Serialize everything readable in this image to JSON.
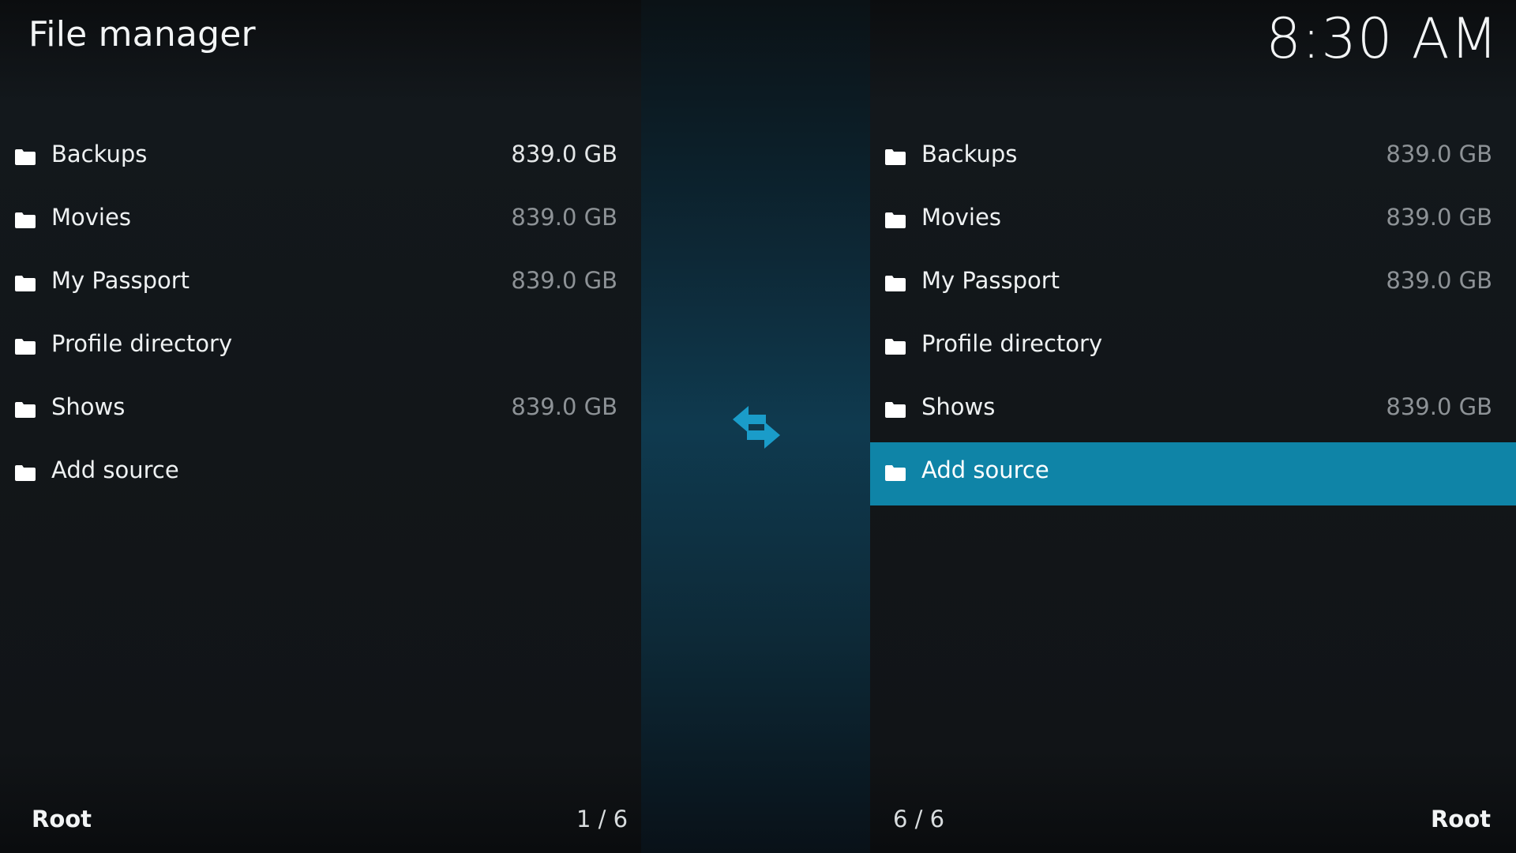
{
  "header": {
    "title": "File manager",
    "clock": "8:30 AM"
  },
  "colors": {
    "accent": "#0f84a7",
    "swap_icon": "#1a9cc9",
    "background": "#111417",
    "muted_text": "#8d9296"
  },
  "left_pane": {
    "items": [
      {
        "label": "Backups",
        "size": "839.0 GB",
        "icon": "folder-icon"
      },
      {
        "label": "Movies",
        "size": "839.0 GB",
        "icon": "folder-icon"
      },
      {
        "label": "My Passport",
        "size": "839.0 GB",
        "icon": "folder-icon"
      },
      {
        "label": "Profile directory",
        "size": "",
        "icon": "folder-icon"
      },
      {
        "label": "Shows",
        "size": "839.0 GB",
        "icon": "folder-icon"
      },
      {
        "label": "Add source",
        "size": "",
        "icon": "folder-icon"
      }
    ],
    "footer_path": "Root",
    "footer_count": "1 / 6"
  },
  "right_pane": {
    "items": [
      {
        "label": "Backups",
        "size": "839.0 GB",
        "icon": "folder-icon"
      },
      {
        "label": "Movies",
        "size": "839.0 GB",
        "icon": "folder-icon"
      },
      {
        "label": "My Passport",
        "size": "839.0 GB",
        "icon": "folder-icon"
      },
      {
        "label": "Profile directory",
        "size": "",
        "icon": "folder-icon"
      },
      {
        "label": "Shows",
        "size": "839.0 GB",
        "icon": "folder-icon"
      },
      {
        "label": "Add source",
        "size": "",
        "icon": "folder-icon",
        "selected": true
      }
    ],
    "footer_path": "Root",
    "footer_count": "6 / 6"
  },
  "center": {
    "icon": "swap-arrows-icon"
  }
}
